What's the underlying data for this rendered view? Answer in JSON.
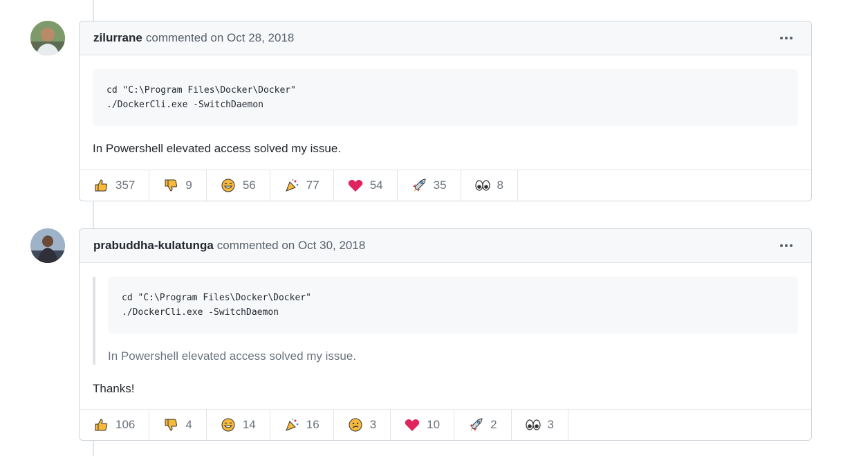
{
  "comments": [
    {
      "author": "zilurrane",
      "meta": "commented on Oct 28, 2018",
      "code": "cd \"C:\\Program Files\\Docker\\Docker\"\n./DockerCli.exe -SwitchDaemon",
      "text": "In Powershell elevated access solved my issue.",
      "reactions": [
        {
          "icon": "thumbs-up-icon",
          "count": "357"
        },
        {
          "icon": "thumbs-down-icon",
          "count": "9"
        },
        {
          "icon": "laugh-icon",
          "count": "56"
        },
        {
          "icon": "hooray-icon",
          "count": "77"
        },
        {
          "icon": "heart-icon",
          "count": "54"
        },
        {
          "icon": "rocket-icon",
          "count": "35"
        },
        {
          "icon": "eyes-icon",
          "count": "8"
        }
      ]
    },
    {
      "author": "prabuddha-kulatunga",
      "meta": "commented on Oct 30, 2018",
      "quote_code": "cd \"C:\\Program Files\\Docker\\Docker\"\n./DockerCli.exe -SwitchDaemon",
      "quote_text": "In Powershell elevated access solved my issue.",
      "text": "Thanks!",
      "reactions": [
        {
          "icon": "thumbs-up-icon",
          "count": "106"
        },
        {
          "icon": "thumbs-down-icon",
          "count": "4"
        },
        {
          "icon": "laugh-icon",
          "count": "14"
        },
        {
          "icon": "hooray-icon",
          "count": "16"
        },
        {
          "icon": "confused-icon",
          "count": "3"
        },
        {
          "icon": "heart-icon",
          "count": "10"
        },
        {
          "icon": "rocket-icon",
          "count": "2"
        },
        {
          "icon": "eyes-icon",
          "count": "3"
        }
      ]
    }
  ],
  "colors": {
    "heart": "#e0245e",
    "thumb": "#f6b93b",
    "border": "#d1d5da",
    "header_bg": "#f6f8fa"
  }
}
